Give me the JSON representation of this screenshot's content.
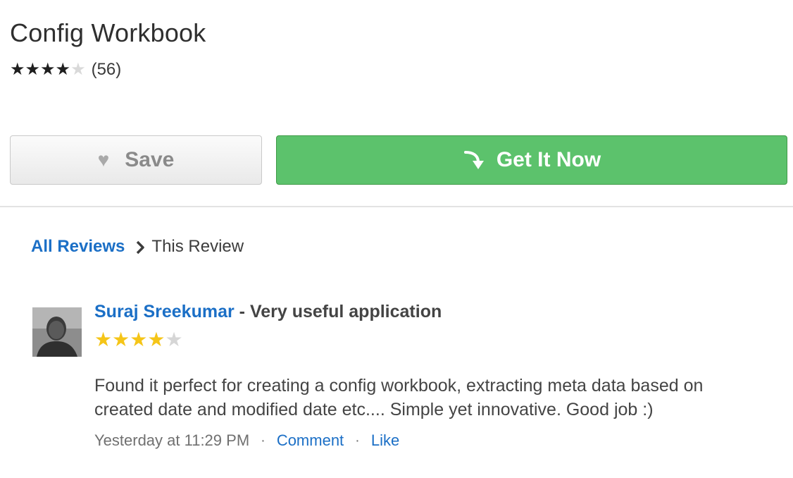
{
  "app": {
    "title": "Config Workbook",
    "rating": 4,
    "max_rating": 5,
    "rating_count": "(56)"
  },
  "actions": {
    "save_label": "Save",
    "save_icon": "heart-icon",
    "get_label": "Get It Now",
    "get_icon": "curved-arrow-icon",
    "get_color": "#5cc26c"
  },
  "breadcrumb": {
    "link_label": "All Reviews",
    "separator_icon": "chevron-right-icon",
    "current_label": "This Review"
  },
  "review": {
    "reviewer": "Suraj Sreekumar",
    "title_separator": " - ",
    "title": "Very useful application",
    "rating": 4,
    "max_rating": 5,
    "star_color": "#f5c518",
    "body": "Found it perfect for creating a config workbook, extracting meta data based on created date and modified date etc.... Simple yet innovative. Good job :)",
    "timestamp": "Yesterday at 11:29 PM",
    "separator": "·",
    "comment_label": "Comment",
    "like_label": "Like"
  },
  "colors": {
    "link": "#1b6fc6",
    "divider": "#e3e3e3"
  }
}
